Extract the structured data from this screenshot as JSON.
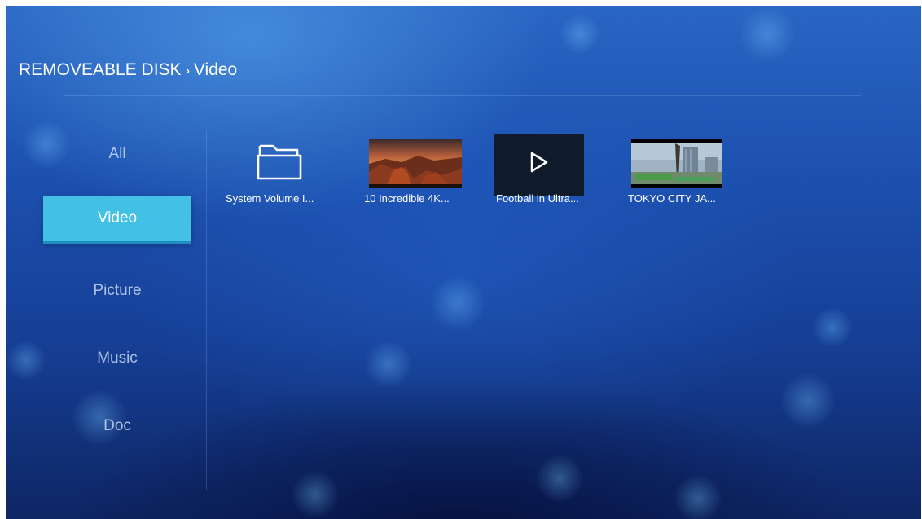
{
  "breadcrumb": {
    "root": "REMOVEABLE DISK",
    "current": "Video"
  },
  "sidebar": {
    "items": [
      {
        "label": "All",
        "selected": false
      },
      {
        "label": "Video",
        "selected": true
      },
      {
        "label": "Picture",
        "selected": false
      },
      {
        "label": "Music",
        "selected": false
      },
      {
        "label": "Doc",
        "selected": false
      }
    ]
  },
  "files": [
    {
      "label": "System Volume I...",
      "kind": "folder",
      "icon": "folder-icon"
    },
    {
      "label": "10 Incredible 4K...",
      "kind": "video",
      "thumbnail": "canyon-sunset"
    },
    {
      "label": "Football in Ultra...",
      "kind": "video",
      "icon": "play-icon",
      "focused": true
    },
    {
      "label": "TOKYO CITY JA...",
      "kind": "video",
      "thumbnail": "city-tower"
    }
  ],
  "colors": {
    "accent": "#43c0e6",
    "background": "#1c4fae",
    "text": "#ffffff"
  }
}
